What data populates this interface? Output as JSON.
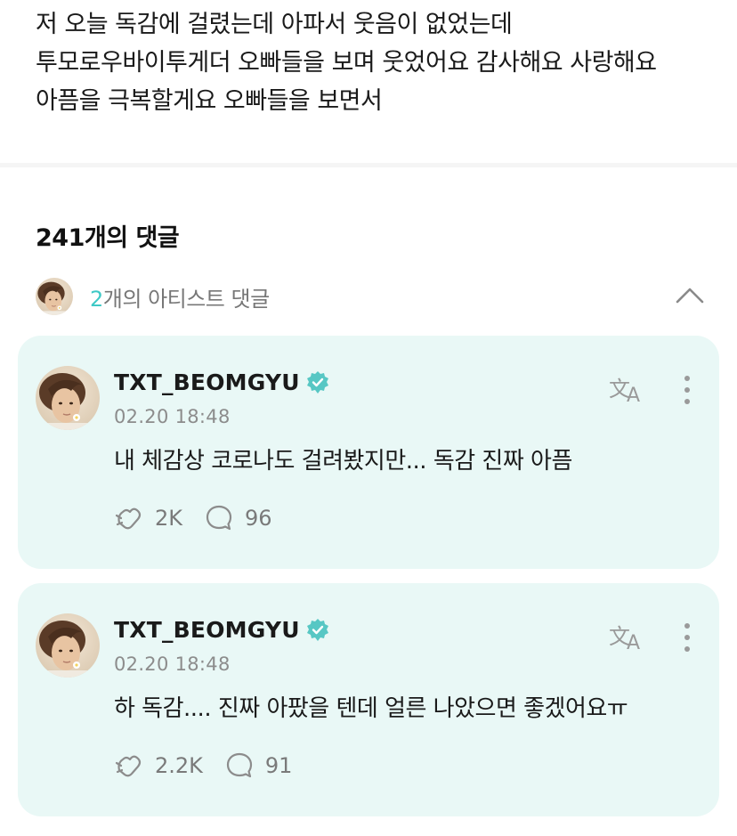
{
  "post": {
    "body": "저 오늘 독감에 걸렸는데 아파서 웃음이 없었는데 투모로우바이투게더 오빠들을 보며 웃었어요 감사해요 사랑해요 아픔을 극복할게요 오빠들을 보면서"
  },
  "comments_section": {
    "count_label": "241개의 댓글",
    "artist_comments": {
      "count": "2",
      "label": "개의 아티스트 댓글"
    }
  },
  "comments": [
    {
      "author": "TXT_BEOMGYU",
      "timestamp": "02.20 18:48",
      "text": "내 체감상 코로나도 걸려봤지만... 독감 진짜 아픔",
      "likes": "2K",
      "replies": "96"
    },
    {
      "author": "TXT_BEOMGYU",
      "timestamp": "02.20 18:48",
      "text": "하 독감.... 진짜 아팠을 텐데 얼른 나았으면 좋겠어요ㅠ",
      "likes": "2.2K",
      "replies": "91"
    }
  ],
  "icons": {
    "verified": "verified-badge-icon",
    "translate": "translate-icon",
    "more": "more-vertical-icon",
    "like": "like-icon",
    "reply": "reply-icon",
    "collapse": "chevron-up-icon"
  },
  "colors": {
    "accent": "#3fc9c6",
    "card_background": "#e9f8f6",
    "muted_text": "#8c8c8c"
  }
}
